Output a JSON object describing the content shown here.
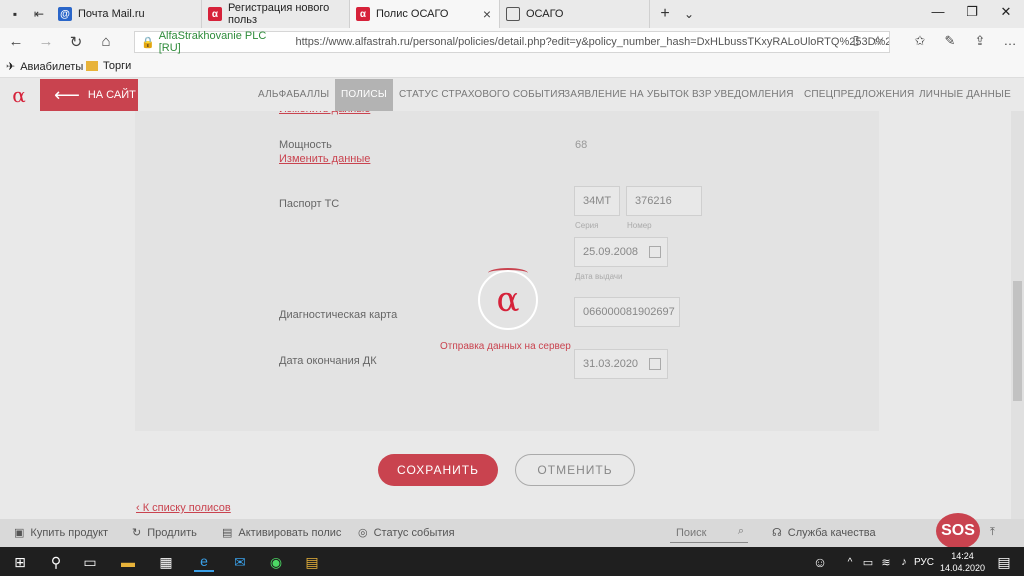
{
  "browser": {
    "tabs": [
      {
        "label": "Почта Mail.ru",
        "favicon": "mail-icon"
      },
      {
        "label": "Регистрация нового польз",
        "favicon": "alfa-icon"
      },
      {
        "label": "Полис ОСАГО",
        "favicon": "alfa-icon"
      },
      {
        "label": "ОСАГО",
        "favicon": "page-icon"
      }
    ],
    "cert_label": "AlfaStrakhovanie PLC [RU]",
    "url": "https://www.alfastrah.ru/personal/policies/detail.php?edit=y&policy_number_hash=DxHLbussTKxyRALoUloRTQ%253D%25"
  },
  "bookmarks": [
    {
      "label": "Авиабилеты"
    },
    {
      "label": "Торги"
    }
  ],
  "site_nav": {
    "back_label": "НА САЙТ",
    "menu": [
      "АЛЬФАБАЛЛЫ",
      "ПОЛИСЫ",
      "СТАТУС СТРАХОВОГО СОБЫТИЯ",
      "ЗАЯВЛЕНИЕ НА УБЫТОК ВЗР",
      "УВЕДОМЛЕНИЯ",
      "СПЕЦПРЕДЛОЖЕНИЯ",
      "ЛИЧНЫЕ ДАННЫЕ"
    ],
    "active_index": 1
  },
  "form": {
    "change_link": "Изменить данные",
    "power_label": "Мощность",
    "power_value": "68",
    "passport_label": "Паспорт ТС",
    "passport_series": "34МТ",
    "passport_number": "376216",
    "series_hint": "Серия",
    "number_hint": "Номер",
    "issue_date": "25.09.2008",
    "issue_hint": "Дата выдачи",
    "diag_label": "Диагностическая карта",
    "diag_value": "066000081902697",
    "dk_end_label": "Дата окончания ДК",
    "dk_end_value": "31.03.2020"
  },
  "loader": {
    "text": "Отправка данных на сервер"
  },
  "actions": {
    "save": "СОХРАНИТЬ",
    "cancel": "ОТМЕНИТЬ",
    "back_to_list": "‹ К списку полисов"
  },
  "footer": {
    "buy": "Купить продукт",
    "extend": "Продлить",
    "activate": "Активировать полис",
    "status": "Статус события",
    "search_placeholder": "Поиск",
    "quality": "Служба качества",
    "sos": "SOS"
  },
  "taskbar": {
    "lang": "РУС",
    "time": "14:24",
    "date": "14.04.2020"
  },
  "colors": {
    "accent": "#c9434f",
    "brand": "#d6223a"
  }
}
